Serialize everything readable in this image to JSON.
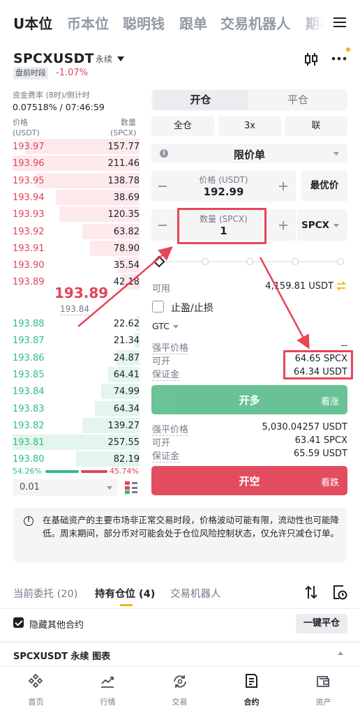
{
  "top_tabs": [
    "U本位",
    "币本位",
    "聪明钱",
    "跟单",
    "交易机器人",
    "期权"
  ],
  "header": {
    "pair": "SPCXUSDT",
    "contract_type": "永续",
    "session": "盘前时段",
    "change": "-1.07%"
  },
  "funding": {
    "label": "资金费率 (8时)/倒计时",
    "value": "0.07518% / 07:46:59"
  },
  "orderbook": {
    "price_label": "价格",
    "price_unit": "(USDT)",
    "qty_label": "数量",
    "qty_unit": "(SPCX)",
    "asks": [
      {
        "price": "193.97",
        "qty": "157.77",
        "depth": 0.9
      },
      {
        "price": "193.96",
        "qty": "211.46",
        "depth": 1.0
      },
      {
        "price": "193.95",
        "qty": "138.78",
        "depth": 0.82
      },
      {
        "price": "193.94",
        "qty": "38.69",
        "depth": 0.66
      },
      {
        "price": "193.93",
        "qty": "120.35",
        "depth": 0.63
      },
      {
        "price": "193.92",
        "qty": "63.82",
        "depth": 0.45
      },
      {
        "price": "193.91",
        "qty": "78.90",
        "depth": 0.39
      },
      {
        "price": "193.90",
        "qty": "35.54",
        "depth": 0.17
      },
      {
        "price": "193.89",
        "qty": "42.18",
        "depth": 0.14
      }
    ],
    "last_price": "193.89",
    "mark_price": "193.84",
    "bids": [
      {
        "price": "193.88",
        "qty": "22.62",
        "depth": 0.03
      },
      {
        "price": "193.87",
        "qty": "21.34",
        "depth": 0.04
      },
      {
        "price": "193.86",
        "qty": "24.87",
        "depth": 0.18
      },
      {
        "price": "193.85",
        "qty": "64.41",
        "depth": 0.25
      },
      {
        "price": "193.84",
        "qty": "74.99",
        "depth": 0.3
      },
      {
        "price": "193.83",
        "qty": "64.34",
        "depth": 0.35
      },
      {
        "price": "193.82",
        "qty": "139.27",
        "depth": 0.45
      },
      {
        "price": "193.81",
        "qty": "257.55",
        "depth": 1.0
      },
      {
        "price": "193.80",
        "qty": "82.19",
        "depth": 0.5
      }
    ],
    "buy_ratio": "54.26%",
    "sell_ratio": "45.74%",
    "precision": "0.01"
  },
  "order_form": {
    "open_tab": "开仓",
    "close_tab": "平仓",
    "margin_mode": "全仓",
    "leverage": "3x",
    "position_mode": "联",
    "order_type": "限价单",
    "price_label": "价格 (USDT)",
    "price_value": "192.99",
    "bbo": "最优价",
    "qty_label": "数量 (SPCX)",
    "qty_value": "1",
    "qty_unit": "SPCX",
    "available_label": "可用",
    "available_value": "4,159.81 USDT",
    "tpsl_label": "止盈/止损",
    "tif": "GTC",
    "long": {
      "liq_label": "强平价格",
      "liq_value": "--",
      "open_label": "可开",
      "open_value": "64.65 SPCX",
      "margin_label": "保证金",
      "margin_value": "64.34 USDT",
      "button": "开多",
      "side_label": "看涨"
    },
    "short": {
      "liq_label": "强平价格",
      "liq_value": "5,030.04257 USDT",
      "open_label": "可开",
      "open_value": "63.41 SPCX",
      "margin_label": "保证金",
      "margin_value": "65.59 USDT",
      "button": "开空",
      "side_label": "看跌"
    }
  },
  "notice": "在基础资产的主要市场非正常交易时段，价格波动可能有限，流动性也可能降低。周末期间，部分币对可能会处于仓位风险控制状态，仅允许只减仓订单。",
  "bottom_tabs": [
    "当前委托 (20)",
    "持有仓位 (4)",
    "交易机器人"
  ],
  "positions": {
    "hide_others": "隐藏其他合约",
    "close_all": "一键平仓",
    "chart_section": "SPCXUSDT 永续 图表"
  },
  "nav": [
    "首页",
    "行情",
    "交易",
    "合约",
    "资产"
  ],
  "colors": {
    "ask": "#e0445a",
    "bid": "#2ebd85",
    "accent": "#f0b90b",
    "annotation": "#e84557"
  }
}
